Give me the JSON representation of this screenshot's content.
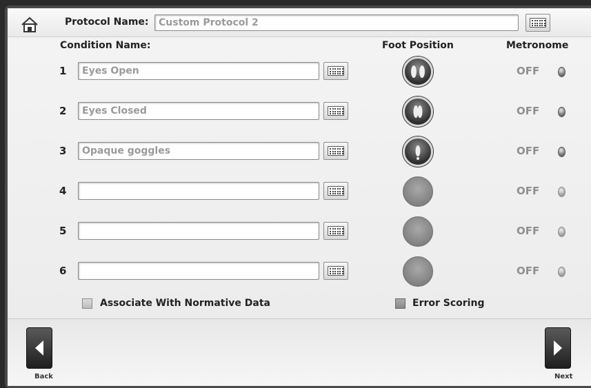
{
  "header": {
    "protocol_label": "Protocol Name:",
    "protocol_value": "Custom Protocol 2"
  },
  "columns": {
    "condition": "Condition Name:",
    "foot": "Foot Position",
    "metronome": "Metronome"
  },
  "rows": [
    {
      "num": "1",
      "name": "Eyes Open",
      "foot": "feet-apart",
      "metronome": "OFF"
    },
    {
      "num": "2",
      "name": "Eyes Closed",
      "foot": "feet-together",
      "metronome": "OFF"
    },
    {
      "num": "3",
      "name": "Opaque goggles",
      "foot": "single-foot",
      "metronome": "OFF"
    },
    {
      "num": "4",
      "name": "",
      "foot": "none",
      "metronome": "OFF"
    },
    {
      "num": "5",
      "name": "",
      "foot": "none",
      "metronome": "OFF"
    },
    {
      "num": "6",
      "name": "",
      "foot": "none",
      "metronome": "OFF"
    }
  ],
  "options": {
    "normative_label": "Associate With Normative Data",
    "normative_checked": false,
    "error_label": "Error Scoring",
    "error_checked": true
  },
  "footer": {
    "back_label": "Back",
    "next_label": "Next"
  },
  "icons": {
    "home": "home-icon",
    "keyboard": "keyboard-icon",
    "back": "left-arrow-icon",
    "next": "right-arrow-icon"
  }
}
